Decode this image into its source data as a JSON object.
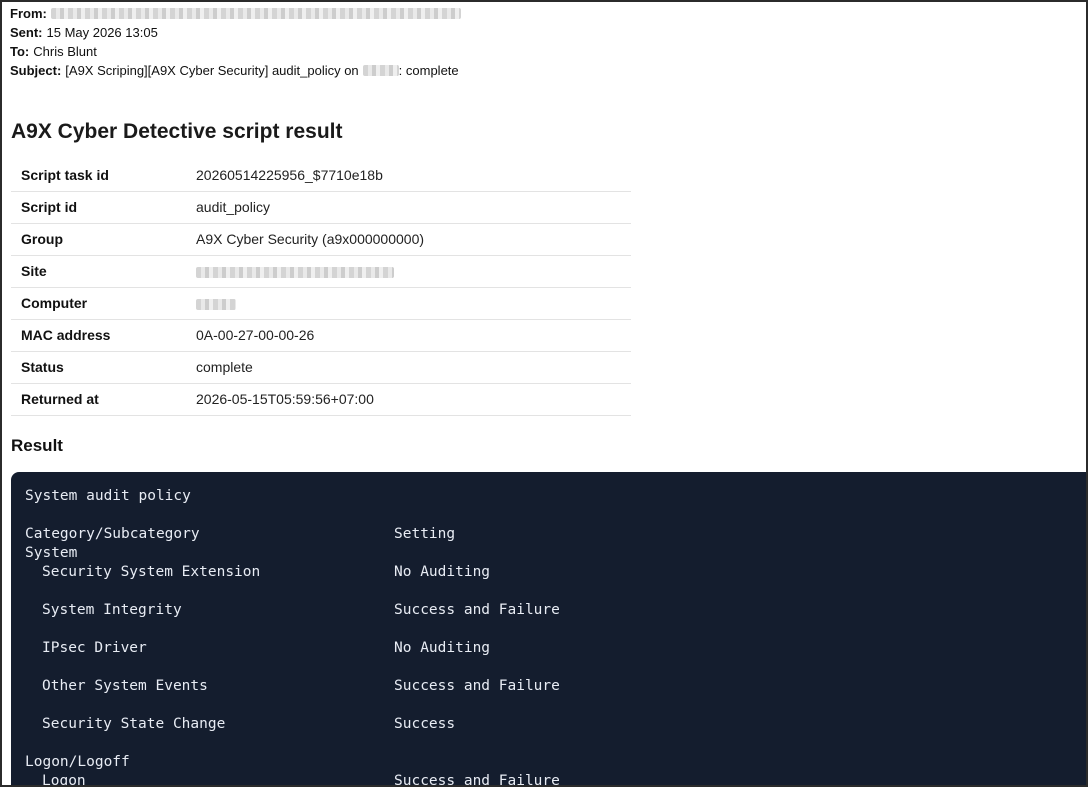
{
  "email": {
    "from_label": "From:",
    "sent_label": "Sent:",
    "sent_value": "15 May 2026 13:05",
    "to_label": "To:",
    "to_value": "Chris Blunt",
    "subject_label": "Subject:",
    "subject_prefix": "[A9X Scriping][A9X Cyber Security] audit_policy on",
    "subject_suffix": ": complete"
  },
  "report": {
    "title": "A9X Cyber Detective script result",
    "rows": [
      {
        "key": "Script task id",
        "value": "20260514225956_$7710e18b"
      },
      {
        "key": "Script id",
        "value": "audit_policy"
      },
      {
        "key": "Group",
        "value": "A9X Cyber Security (a9x000000000)"
      },
      {
        "key": "Site",
        "value": ""
      },
      {
        "key": "Computer",
        "value": ""
      },
      {
        "key": "MAC address",
        "value": "0A-00-27-00-00-26"
      },
      {
        "key": "Status",
        "value": "complete"
      },
      {
        "key": "Returned at",
        "value": "2026-05-15T05:59:56+07:00"
      }
    ],
    "result_heading": "Result"
  },
  "terminal": {
    "heading": "System audit policy",
    "col_category": "Category/Subcategory",
    "col_setting": "Setting",
    "category_system": "System",
    "system_items": [
      {
        "name": "Security System Extension",
        "setting": "No Auditing"
      },
      {
        "name": "System Integrity",
        "setting": "Success and Failure"
      },
      {
        "name": "IPsec Driver",
        "setting": "No Auditing"
      },
      {
        "name": "Other System Events",
        "setting": "Success and Failure"
      },
      {
        "name": "Security State Change",
        "setting": "Success"
      }
    ],
    "category_logon": "Logon/Logoff",
    "logon_items": [
      {
        "name": "Logon",
        "setting": "Success and Failure"
      }
    ]
  },
  "colors": {
    "terminal_bg": "#141d2e",
    "terminal_text": "#e8ecf4",
    "frame_border": "#2b2b2b"
  }
}
